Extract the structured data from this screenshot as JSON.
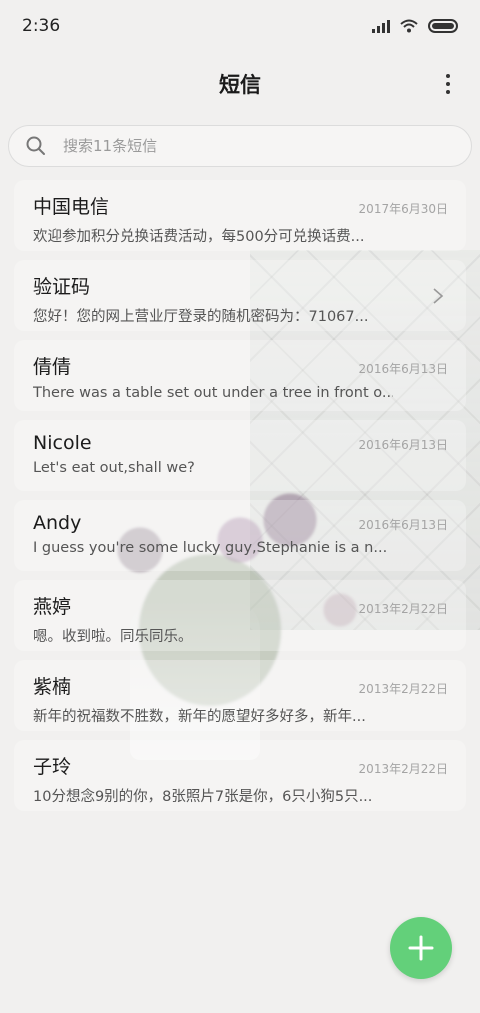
{
  "status_bar": {
    "time": "2:36"
  },
  "header": {
    "title": "短信"
  },
  "search": {
    "placeholder": "搜索11条短信"
  },
  "conversations": [
    {
      "name": "中国电信",
      "date": "2017年6月30日",
      "preview": "欢迎参加积分兑换话费活动，每500分可兑换话费..."
    },
    {
      "name": "验证码",
      "date": "",
      "preview": "您好！您的网上营业厅登录的随机密码为：71067..."
    },
    {
      "name": "倩倩",
      "date": "2016年6月13日",
      "preview": "There was a table set out under a tree in front o..."
    },
    {
      "name": "Nicole",
      "date": "2016年6月13日",
      "preview": "Let's eat out,shall we?"
    },
    {
      "name": "Andy",
      "date": "2016年6月13日",
      "preview": "I guess you're some lucky guy,Stephanie is a n..."
    },
    {
      "name": "燕婷",
      "date": "2013年2月22日",
      "preview": "嗯。收到啦。同乐同乐。"
    },
    {
      "name": "紫楠",
      "date": "2013年2月22日",
      "preview": "新年的祝福数不胜数，新年的愿望好多好多，新年..."
    },
    {
      "name": "子玲",
      "date": "2013年2月22日",
      "preview": "10分想念9别的你，8张照片7张是你，6只小狗5只..."
    }
  ],
  "icons": {
    "search": "search-icon",
    "more": "more-vertical-icon",
    "chevron": "chevron-right-icon",
    "add": "plus-icon"
  },
  "colors": {
    "fab": "#63d07a"
  }
}
